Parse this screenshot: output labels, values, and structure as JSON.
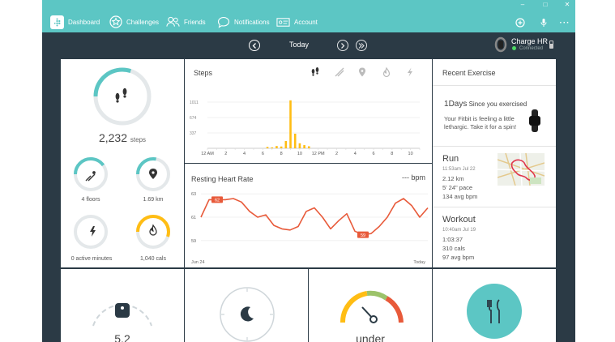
{
  "nav": {
    "items": [
      {
        "label": "Dashboard",
        "icon": "fitbit-logo-icon"
      },
      {
        "label": "Challenges",
        "icon": "star-icon"
      },
      {
        "label": "Friends",
        "icon": "friends-icon"
      },
      {
        "label": "Notifications",
        "icon": "chat-icon"
      },
      {
        "label": "Account",
        "icon": "id-card-icon"
      }
    ]
  },
  "date": {
    "label": "Today"
  },
  "device": {
    "name": "Charge HR",
    "status": "Connected"
  },
  "stats": {
    "steps_value": "2,232",
    "steps_unit": "steps",
    "steps_progress": 0.3,
    "floors": "4",
    "floors_unit": "floors",
    "floors_progress": 0.4,
    "km": "1.69",
    "km_unit": "km",
    "km_progress": 0.28,
    "active": "0",
    "active_unit": "active minutes",
    "active_progress": 0,
    "cals": "1,040",
    "cals_unit": "cals",
    "cals_progress": 0.55
  },
  "steps_chart": {
    "title": "Steps",
    "tab_icons": [
      "steps-icon",
      "distance-icon",
      "location-icon",
      "calories-icon",
      "active-minutes-icon"
    ]
  },
  "chart_data": [
    {
      "type": "bar",
      "title": "Steps",
      "y_ticks": [
        "1011",
        "674",
        "337"
      ],
      "x_ticks": [
        "12 AM",
        "2",
        "4",
        "6",
        "8",
        "10",
        "12 PM",
        "2",
        "4",
        "6",
        "8",
        "10"
      ],
      "x": [
        6.5,
        7,
        7.5,
        8,
        8.5,
        9,
        9.5,
        10,
        10.5,
        11
      ],
      "values": [
        30,
        20,
        50,
        40,
        160,
        1050,
        320,
        110,
        70,
        45
      ],
      "ylim": [
        0,
        1100
      ]
    },
    {
      "type": "line",
      "title": "Resting Heart Rate",
      "unit": "--- bpm",
      "y_ticks": [
        "63",
        "61",
        "59"
      ],
      "x_start": "Jun 24",
      "x_end": "Today",
      "values": [
        61,
        62.5,
        62.5,
        62.5,
        62.6,
        62.3,
        61.5,
        61,
        61.2,
        60.3,
        60,
        59.9,
        60.2,
        61.5,
        61.8,
        61,
        60,
        60.7,
        61.3,
        59.8,
        59.5,
        59.6,
        60.2,
        61,
        62.2,
        62.6,
        62,
        61,
        61.8
      ],
      "labels": [
        {
          "index": 2,
          "text": "62"
        },
        {
          "index": 20,
          "text": "59"
        }
      ],
      "ylim": [
        58.5,
        63.5
      ]
    }
  ],
  "recent": {
    "title": "Recent Exercise",
    "days_value": "1",
    "days_unit": "Days",
    "days_text": "Since you exercised",
    "msg": "Your Fitbit is feeling a little lethargic. Take it for a spin!",
    "run": {
      "title": "Run",
      "time": "11:53am Jul 22",
      "l1": "2.12 km",
      "l2": "5' 24\" pace",
      "l3": "134 avg bpm"
    },
    "workout": {
      "title": "Workout",
      "time": "10:40am Jul 19",
      "l1": "1:03:37",
      "l2": "310 cals",
      "l3": "97 avg bpm"
    }
  },
  "bottom": {
    "weight_partial": "5.2",
    "mood_partial": "under"
  },
  "colors": {
    "teal": "#5cc6c4",
    "orange": "#ffbd14",
    "line": "#e85a3a",
    "dark": "#2b3a45"
  }
}
